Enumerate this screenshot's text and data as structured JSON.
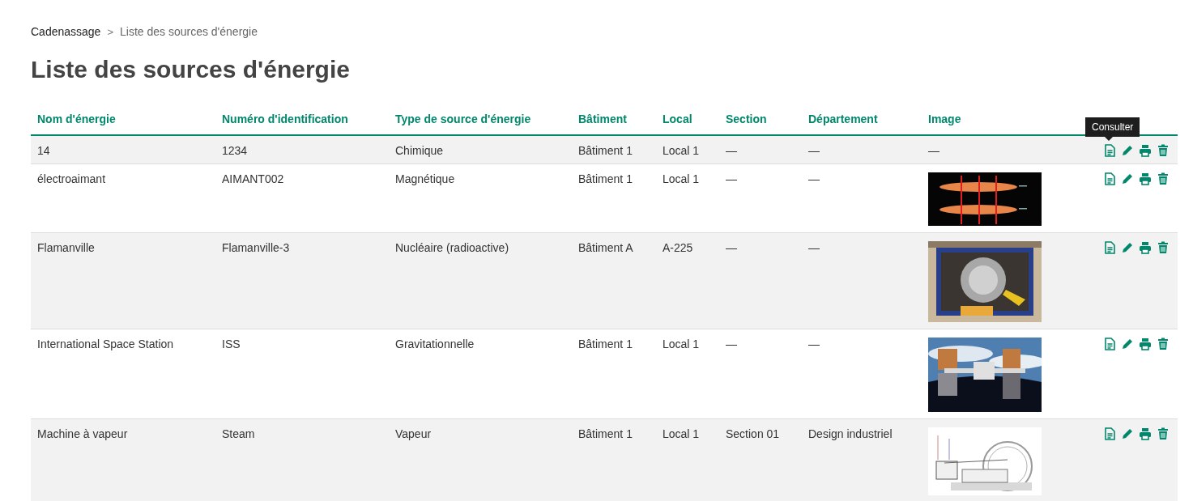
{
  "breadcrumb": [
    {
      "label": "Cadenassage",
      "current": false
    },
    {
      "label": "Liste des sources d'énergie",
      "current": true
    }
  ],
  "breadcrumb_separator": ">",
  "title": "Liste des sources d'énergie",
  "table": {
    "columns": [
      "Nom d'énergie",
      "Numéro d'identification",
      "Type de source d'énergie",
      "Bâtiment",
      "Local",
      "Section",
      "Département",
      "Image"
    ],
    "rows": [
      {
        "cells": [
          "14",
          "1234",
          "Chimique",
          "Bâtiment 1",
          "Local 1",
          "—",
          "—"
        ],
        "image": {
          "kind": "text",
          "text": "—"
        },
        "tooltip": "Consulter"
      },
      {
        "cells": [
          "électroaimant",
          "AIMANT002",
          "Magnétique",
          "Bâtiment 1",
          "Local 1",
          "—",
          "—"
        ],
        "image": {
          "kind": "picture"
        }
      },
      {
        "cells": [
          "Flamanville",
          "Flamanville-3",
          "Nucléaire (radioactive)",
          "Bâtiment A",
          "A-225",
          "—",
          "—"
        ],
        "image": {
          "kind": "picture"
        }
      },
      {
        "cells": [
          "International Space Station",
          "ISS",
          "Gravitationnelle",
          "Bâtiment 1",
          "Local 1",
          "—",
          "—"
        ],
        "image": {
          "kind": "picture"
        }
      },
      {
        "cells": [
          "Machine à vapeur",
          "Steam",
          "Vapeur",
          "Bâtiment 1",
          "Local 1",
          "Section 01",
          "Design industriel"
        ],
        "image": {
          "kind": "picture"
        }
      }
    ]
  }
}
